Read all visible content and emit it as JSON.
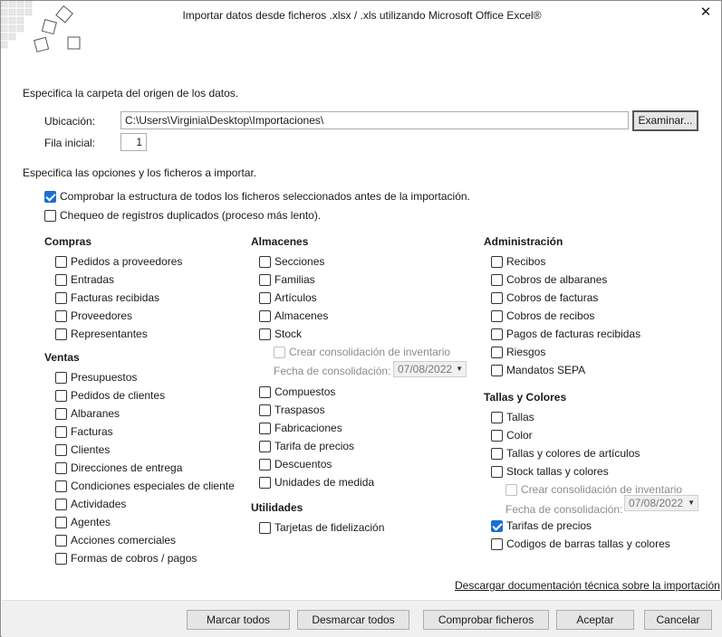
{
  "window": {
    "title": "Importar datos desde ficheros .xlsx / .xls utilizando Microsoft Office Excel®",
    "close": "✕"
  },
  "origin": {
    "heading": "Especifica la carpeta del origen de los datos.",
    "location_label": "Ubicación:",
    "location_value": "C:\\Users\\Virginia\\Desktop\\Importaciones\\",
    "browse_label": "Examinar...",
    "start_row_label": "Fila inicial:",
    "start_row_value": "1"
  },
  "options": {
    "heading": "Especifica las opciones y los ficheros a importar.",
    "check_structure": {
      "label": "Comprobar la estructura de todos los ficheros seleccionados antes de la importación.",
      "checked": true
    },
    "check_duplicates": {
      "label": "Chequeo de registros duplicados (proceso más lento).",
      "checked": false
    }
  },
  "compras": {
    "title": "Compras",
    "items": [
      "Pedidos a proveedores",
      "Entradas",
      "Facturas recibidas",
      "Proveedores",
      "Representantes"
    ]
  },
  "ventas": {
    "title": "Ventas",
    "items": [
      "Presupuestos",
      "Pedidos de clientes",
      "Albaranes",
      "Facturas",
      "Clientes",
      "Direcciones de entrega",
      "Condiciones especiales de cliente",
      "Actividades",
      "Agentes",
      "Acciones comerciales",
      "Formas de cobros / pagos"
    ]
  },
  "almacenes": {
    "title": "Almacenes",
    "items": [
      "Secciones",
      "Familias",
      "Artículos",
      "Almacenes",
      "Stock"
    ],
    "consolidation_label": "Crear consolidación de inventario",
    "date_label": "Fecha de consolidación:",
    "date_value": "07/08/2022",
    "items2": [
      "Compuestos",
      "Traspasos",
      "Fabricaciones",
      "Tarifa de precios",
      "Descuentos",
      "Unidades de medida"
    ]
  },
  "utilidades": {
    "title": "Utilidades",
    "items": [
      "Tarjetas de fidelización"
    ]
  },
  "administracion": {
    "title": "Administración",
    "items": [
      "Recibos",
      "Cobros de albaranes",
      "Cobros de facturas",
      "Cobros de recibos",
      "Pagos de facturas recibidas",
      "Riesgos",
      "Mandatos SEPA"
    ]
  },
  "tallas": {
    "title": "Tallas y Colores",
    "items": [
      "Tallas",
      "Color",
      "Tallas y colores de artículos",
      "Stock tallas y colores"
    ],
    "consolidation_label": "Crear consolidación de inventario",
    "date_label": "Fecha de consolidación:",
    "date_value": "07/08/2022",
    "tarifas": {
      "label": "Tarifas de precios",
      "checked": true
    },
    "codigos": "Codigos de barras tallas y colores"
  },
  "link": "Descargar documentación técnica sobre la importación",
  "buttons": {
    "mark_all": "Marcar todos",
    "unmark_all": "Desmarcar todos",
    "check_files": "Comprobar ficheros",
    "accept": "Aceptar",
    "cancel": "Cancelar"
  }
}
